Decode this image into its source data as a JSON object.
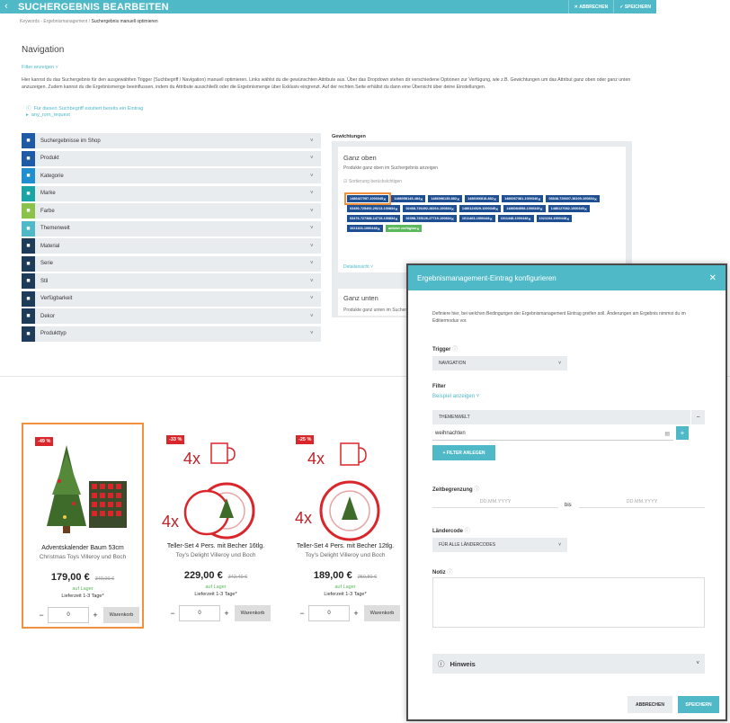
{
  "header": {
    "title": "SUCHERGEBNIS BEARBEITEN",
    "cancel": "ABBRECHEN",
    "save": "SPEICHERN"
  },
  "breadcrumb": {
    "part1": "Keywords - Ergebnismanagement",
    "sep": "/",
    "current": "Suchergebnis manuell optimieren"
  },
  "page": {
    "heading": "Navigation",
    "filter_link": "Filter anzeigen",
    "description": "Hier kannst du das Suchergebnis für den ausgewählten Trigger (Suchbegriff / Navigation) manuell optimieren. Links wählst du die gewünschten Attribute aus. Über das Dropdown stehen dir verschiedene Optionen zur Verfügung, wie z.B. Gewichtungen um das Attribut ganz oben oder ganz unten anzuzeigen. Zudem kannst du die Ergebnismenge beeinflussen, indem du Attribute ausschließt oder die Ergebnismenge über Exklusiv eingrenzt. Auf der rechten Seite erhältst du dann eine Übersicht über deine Einstellungen.",
    "info1": "Für diesen Suchbegriff existiert bereits ein Eintrag",
    "info2": "any_rorn_request"
  },
  "attributes": [
    {
      "label": "Suchergebnisse im Shop",
      "color": "#1f5aa6",
      "icon": "tag-icon"
    },
    {
      "label": "Produkt",
      "color": "#1f5aa6",
      "icon": "tag-icon"
    },
    {
      "label": "Kategorie",
      "color": "#1f8fd0",
      "icon": "sitemap-icon"
    },
    {
      "label": "Marke",
      "color": "#19a5a5",
      "icon": "star-icon"
    },
    {
      "label": "Farbe",
      "color": "#8bc34a",
      "icon": "drop-icon"
    },
    {
      "label": "Themenwelt",
      "color": "#4fb9c7",
      "icon": "image-icon"
    },
    {
      "label": "Material",
      "color": "#1f3b5a",
      "icon": "material-icon"
    },
    {
      "label": "Serie",
      "color": "#1f3b5a",
      "icon": "series-icon"
    },
    {
      "label": "Stil",
      "color": "#1f3b5a",
      "icon": "style-icon"
    },
    {
      "label": "Verfügbarkeit",
      "color": "#1f3b5a",
      "icon": "truck-icon"
    },
    {
      "label": "Dekor",
      "color": "#1f3b5a",
      "icon": "dekor-icon"
    },
    {
      "label": "Produkttyp",
      "color": "#1f3b5a",
      "icon": "type-icon"
    }
  ],
  "weights": {
    "heading": "Gewichtungen",
    "top_title": "Ganz oben",
    "top_sub": "Produkte ganz oben im Suchergebnis anzeigen",
    "checkbox": "Sortierung berücksichtigen",
    "detail_link": "Detailansicht",
    "bottom_title": "Ganz unten",
    "bottom_sub": "Produkte ganz unten im Suchergebnis anzeigen",
    "tags": [
      "1486427057-1000345",
      "1486058145-484",
      "1486096135-882",
      "1486066818-882",
      "1486067381-1000346",
      "03848-726607-38109-100834",
      "03450-725492-29213-100834",
      "02468-726492-28264-100834",
      "1486124529-1000345",
      "1486084558-1000345",
      "1486127082-1000345",
      "03476-727388-14715-100834",
      "02398-725126-27719-100834",
      "1011463-1000448",
      "1011448-1000448",
      "1021104-1000448",
      "1021103-1000448"
    ],
    "green_tag": "anfahrt verfügbar"
  },
  "products": [
    {
      "badge": "-49 %",
      "name": "Adventskalender Baum 53cm",
      "brand": "Christmas Toys Villeroy und Boch",
      "price": "179,00 €",
      "old": "349,00 €",
      "stock": "auf Lager",
      "delivery": "Lieferzeit 1-3 Tage*",
      "qty": "0",
      "cart": "Warenkorb"
    },
    {
      "badge": "-33 %",
      "name": "Teller-Set 4 Pers. mit Becher 16tlg.",
      "brand": "Toy's Delight Villeroy und Boch",
      "price": "229,00 €",
      "old": "342,40 €",
      "stock": "auf Lager",
      "delivery": "Lieferzeit 1-3 Tage*",
      "qty": "0",
      "cart": "Warenkorb",
      "count_label": "4x"
    },
    {
      "badge": "-25 %",
      "name": "Teller-Set 4 Pers. mit Becher 12tlg.",
      "brand": "Toy's Delight Villeroy und Boch",
      "price": "189,00 €",
      "old": "250,80 €",
      "stock": "auf Lager",
      "delivery": "Lieferzeit 1-3 Tage*",
      "qty": "0",
      "cart": "Warenkorb",
      "count_label": "4x"
    }
  ],
  "modal": {
    "title": "Ergebnismanagement-Eintrag konfigurieren",
    "text": "Definiere hier, bei welchen Bedingungen der Ergebnismanagement Eintrag greifen soll. Änderungen am Ergebnis nimmst du im Editiermodus vor.",
    "trigger_label": "Trigger",
    "trigger_value": "NAVIGATION",
    "filter_label": "Filter",
    "example_link": "Beispiel anzeigen",
    "themen": "THEMENWELT",
    "value": "weihnachten",
    "add_filter": "+ FILTER ANLEGEN",
    "zeit_label": "Zeitbegrenzung",
    "date_ph": "DD.MM.YYYY",
    "bis": "bis",
    "laender_label": "Ländercode",
    "laender_value": "FÜR ALLE LÄNDERCODES",
    "notiz_label": "Notiz",
    "hinweis": "Hinweis",
    "cancel": "ABBRECHEN",
    "save": "SPEICHERN"
  }
}
